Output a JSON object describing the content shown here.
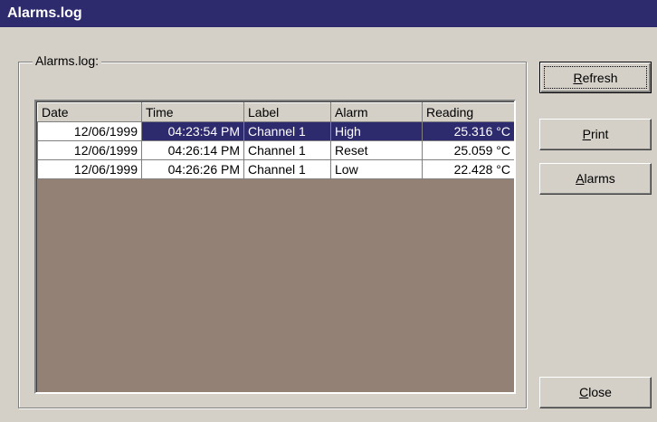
{
  "window": {
    "title": "Alarms.log"
  },
  "group": {
    "label": "Alarms.log:"
  },
  "table": {
    "columns": [
      "Date",
      "Time",
      "Label",
      "Alarm",
      "Reading"
    ],
    "selected_row": 0,
    "rows": [
      {
        "date": "12/06/1999",
        "time": "04:23:54 PM",
        "label": "Channel 1",
        "alarm": "High",
        "reading": "25.316 °C"
      },
      {
        "date": "12/06/1999",
        "time": "04:26:14 PM",
        "label": "Channel 1",
        "alarm": "Reset",
        "reading": "25.059 °C"
      },
      {
        "date": "12/06/1999",
        "time": "04:26:26 PM",
        "label": "Channel 1",
        "alarm": "Low",
        "reading": "22.428 °C"
      }
    ]
  },
  "buttons": {
    "refresh": {
      "mnemonic": "R",
      "rest": "efresh"
    },
    "print": {
      "mnemonic": "P",
      "rest": "rint"
    },
    "alarms": {
      "mnemonic": "A",
      "rest": "larms"
    },
    "close": {
      "mnemonic": "C",
      "rest": "lose"
    }
  },
  "colors": {
    "titlebar": "#2e2a6e",
    "selection": "#2e2a6e",
    "list_background": "#948176",
    "face": "#d4d0c8"
  }
}
